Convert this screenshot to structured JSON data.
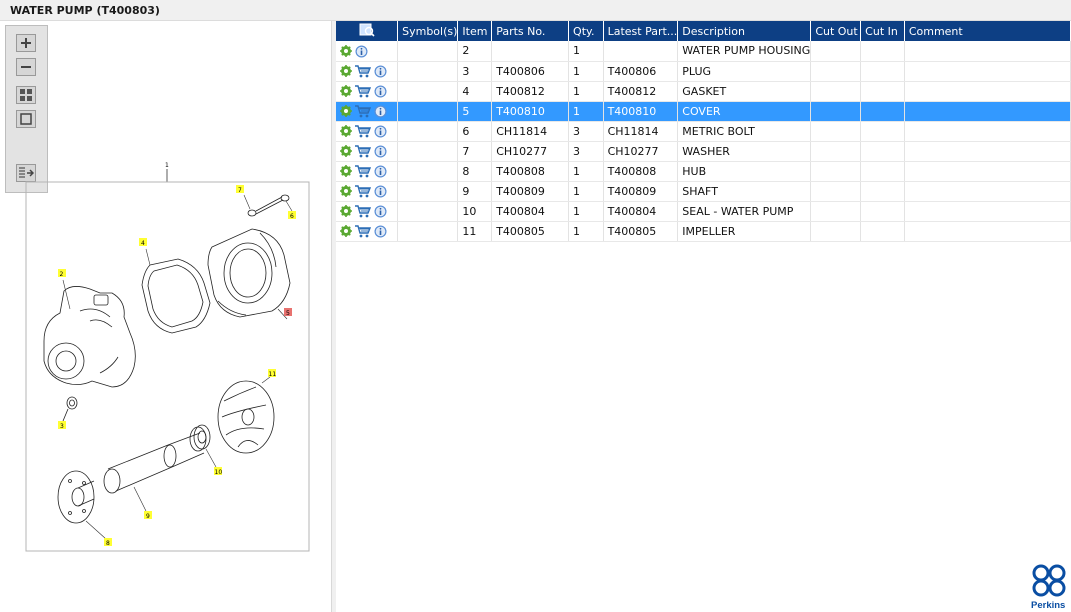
{
  "window": {
    "title": "WATER PUMP (T400803)"
  },
  "toolbar": {
    "buttons": [
      {
        "name": "zoom-in",
        "icon": "plus-icon"
      },
      {
        "name": "zoom-out",
        "icon": "minus-icon"
      },
      {
        "name": "fit",
        "icon": "fit-icon"
      },
      {
        "name": "actual-size",
        "icon": "square-icon"
      },
      {
        "name": "export",
        "icon": "export-icon"
      }
    ]
  },
  "diagram": {
    "callouts": [
      "1",
      "2",
      "3",
      "4",
      "5",
      "6",
      "7",
      "8",
      "9",
      "10",
      "11"
    ],
    "highlight_color": "#ffff33",
    "selected_color": "#e8726f"
  },
  "table": {
    "columns": [
      "",
      "Symbol(s)",
      "Item",
      "Parts No.",
      "Qty.",
      "Latest Part...",
      "Description",
      "Cut Out",
      "Cut In",
      "Comment"
    ],
    "header_color": "#0d3f84",
    "selected_color": "#3399ff",
    "rows": [
      {
        "cart": false,
        "item": "2",
        "part_no": "",
        "qty": "1",
        "latest": "",
        "desc": "WATER PUMP HOUSING",
        "selected": false
      },
      {
        "cart": true,
        "item": "3",
        "part_no": "T400806",
        "qty": "1",
        "latest": "T400806",
        "desc": "PLUG",
        "selected": false
      },
      {
        "cart": true,
        "item": "4",
        "part_no": "T400812",
        "qty": "1",
        "latest": "T400812",
        "desc": "GASKET",
        "selected": false
      },
      {
        "cart": true,
        "item": "5",
        "part_no": "T400810",
        "qty": "1",
        "latest": "T400810",
        "desc": "COVER",
        "selected": true
      },
      {
        "cart": true,
        "item": "6",
        "part_no": "CH11814",
        "qty": "3",
        "latest": "CH11814",
        "desc": "METRIC BOLT",
        "selected": false
      },
      {
        "cart": true,
        "item": "7",
        "part_no": "CH10277",
        "qty": "3",
        "latest": "CH10277",
        "desc": "WASHER",
        "selected": false
      },
      {
        "cart": true,
        "item": "8",
        "part_no": "T400808",
        "qty": "1",
        "latest": "T400808",
        "desc": "HUB",
        "selected": false
      },
      {
        "cart": true,
        "item": "9",
        "part_no": "T400809",
        "qty": "1",
        "latest": "T400809",
        "desc": "SHAFT",
        "selected": false
      },
      {
        "cart": true,
        "item": "10",
        "part_no": "T400804",
        "qty": "1",
        "latest": "T400804",
        "desc": "SEAL - WATER PUMP",
        "selected": false
      },
      {
        "cart": true,
        "item": "11",
        "part_no": "T400805",
        "qty": "1",
        "latest": "T400805",
        "desc": "IMPELLER",
        "selected": false
      }
    ]
  },
  "brand": {
    "name": "Perkins",
    "color": "#0a4ea3"
  }
}
